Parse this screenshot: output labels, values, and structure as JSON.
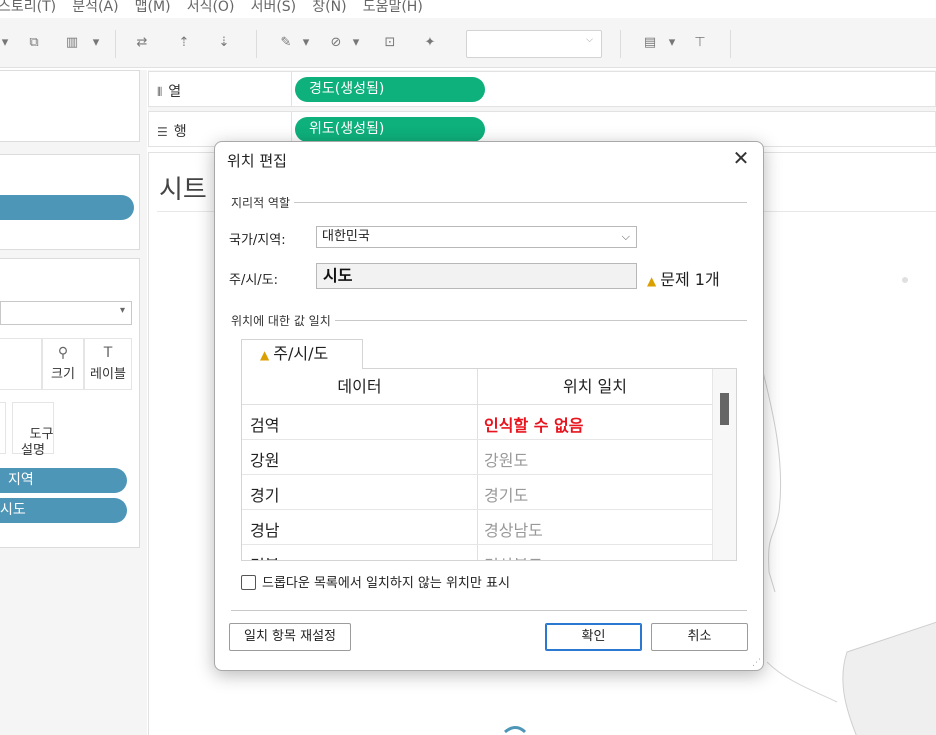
{
  "menubar": {
    "items": [
      "스토리(T)",
      "분석(A)",
      "맵(M)",
      "서식(O)",
      "서버(S)",
      "창(N)",
      "도움말(H)"
    ]
  },
  "shelves": {
    "columns_label": "열",
    "rows_label": "행",
    "columns_pill": "경도(생성됨)",
    "rows_pill": "위도(생성됨)"
  },
  "left": {
    "size_label": "크기",
    "label_label": "레이블",
    "tooltip_label": "도구\n설명",
    "pill_region": "지역",
    "pill_sido": "시도"
  },
  "sheet": {
    "title": "시트"
  },
  "dialog": {
    "title": "위치 편집",
    "close": "✕",
    "geo_role_section": "지리적 역할",
    "country_label": "국가/지역:",
    "country_value": "대한민국",
    "state_label": "주/시/도:",
    "state_value": "시도",
    "issue_text": "문제 1개",
    "match_section": "위치에 대한 값 일치",
    "tab_label": "주/시/도",
    "table": {
      "headers": [
        "데이터",
        "위치 일치"
      ],
      "rows": [
        {
          "data": "검역",
          "match": "인식할 수 없음",
          "unrecognized": true
        },
        {
          "data": "강원",
          "match": "강원도",
          "unrecognized": false
        },
        {
          "data": "경기",
          "match": "경기도",
          "unrecognized": false
        },
        {
          "data": "경남",
          "match": "경상남도",
          "unrecognized": false
        },
        {
          "data": "경북",
          "match": "경상북도",
          "unrecognized": false
        }
      ]
    },
    "checkbox_label": "드롭다운 목록에서 일치하지 않는 위치만 표시",
    "reset_button": "일치 항목 재설정",
    "ok_button": "확인",
    "cancel_button": "취소"
  },
  "colors": {
    "green_pill": "#0eb07b",
    "blue_pill": "#4e96b8",
    "error_red": "#e8141e",
    "warning": "#d9a000",
    "primary_border": "#2b78d0"
  }
}
